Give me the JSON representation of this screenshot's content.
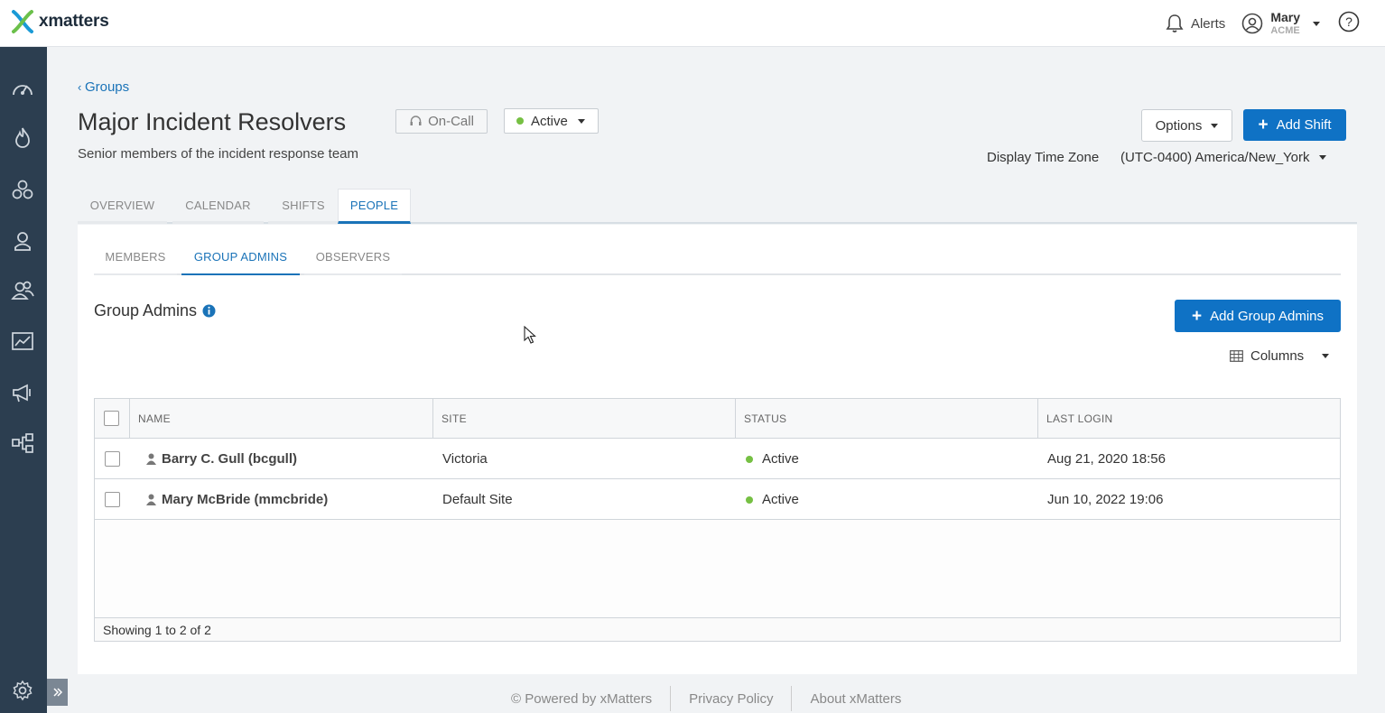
{
  "brand": {
    "name": "xmatters"
  },
  "topbar": {
    "alerts_label": "Alerts",
    "user_name": "Mary",
    "user_org": "ACME"
  },
  "sidebar": {
    "items": [
      "dashboard-icon",
      "incidents-icon",
      "groups-icon",
      "users-icon",
      "teams-icon",
      "reports-icon",
      "messaging-icon",
      "workflows-icon"
    ],
    "settings": "settings-icon"
  },
  "header": {
    "breadcrumb": "Groups",
    "title": "Major Incident Resolvers",
    "oncall_label": "On-Call",
    "status_label": "Active",
    "description": "Senior members of the incident response team",
    "options_label": "Options",
    "add_shift_label": "Add Shift",
    "timezone_label": "Display Time Zone",
    "timezone_value": "(UTC-0400) America/New_York"
  },
  "tabs": [
    {
      "label": "OVERVIEW",
      "active": false
    },
    {
      "label": "CALENDAR",
      "active": false
    },
    {
      "label": "SHIFTS",
      "active": false
    },
    {
      "label": "PEOPLE",
      "active": true
    }
  ],
  "subtabs": [
    {
      "label": "MEMBERS",
      "active": false
    },
    {
      "label": "GROUP ADMINS",
      "active": true
    },
    {
      "label": "OBSERVERS",
      "active": false
    }
  ],
  "section": {
    "title": "Group Admins",
    "add_button": "Add Group Admins",
    "columns_label": "Columns"
  },
  "table": {
    "columns": [
      "NAME",
      "SITE",
      "STATUS",
      "LAST LOGIN"
    ],
    "rows": [
      {
        "name": "Barry C. Gull (bcgull)",
        "site": "Victoria",
        "status": "Active",
        "last_login": "Aug 21, 2020 18:56"
      },
      {
        "name": "Mary McBride (mmcbride)",
        "site": "Default Site",
        "status": "Active",
        "last_login": "Jun 10, 2022 19:06"
      }
    ],
    "footer": "Showing 1 to 2 of 2"
  },
  "footer": {
    "powered": "© Powered by xMatters",
    "privacy": "Privacy Policy",
    "about": "About xMatters"
  },
  "colors": {
    "primary": "#0f72c5",
    "sidebar": "#2c3e50",
    "active_status": "#76c043"
  }
}
